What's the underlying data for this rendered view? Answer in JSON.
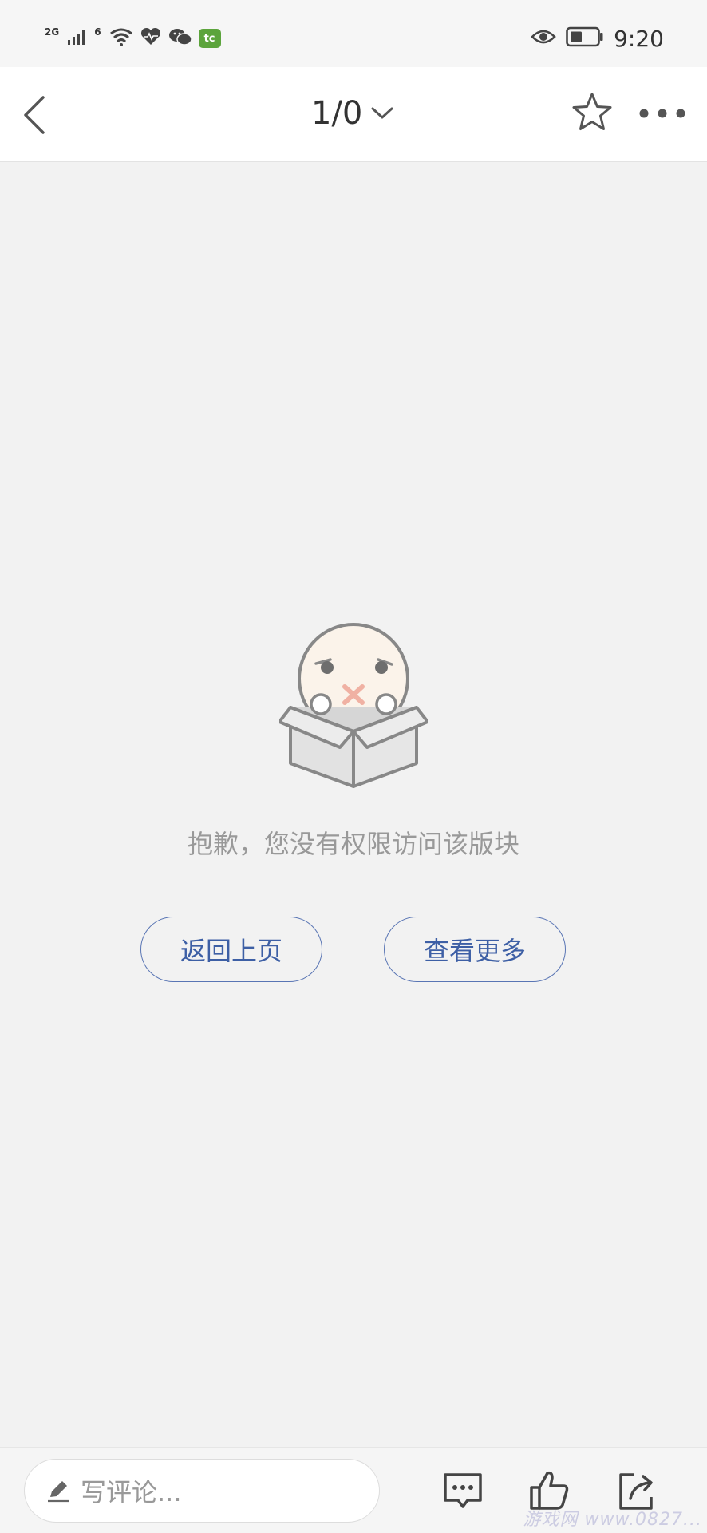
{
  "status_bar": {
    "network_1": "2G",
    "network_2": "6",
    "app_badge": "tc",
    "time": "9:20",
    "icons": [
      "signal-icon",
      "wifi-icon",
      "health-icon",
      "wechat-icon",
      "app-badge-icon",
      "eye-icon",
      "battery-icon"
    ]
  },
  "header": {
    "page_indicator": "1/0",
    "icons": [
      "back-arrow-icon",
      "chevron-down-icon",
      "star-icon",
      "more-dots-icon"
    ]
  },
  "empty_state": {
    "message": "抱歉，您没有权限访问该版块",
    "back_label": "返回上页",
    "more_label": "查看更多",
    "illustration": "sad-face-in-box"
  },
  "bottom_bar": {
    "comment_placeholder": "写评论...",
    "icons": [
      "pencil-icon",
      "comment-icon",
      "like-icon",
      "share-icon"
    ],
    "watermark": "游戏网 www.0827..."
  },
  "colors": {
    "background": "#f2f2f2",
    "accent": "#3d5fa5",
    "message": "#999999"
  }
}
